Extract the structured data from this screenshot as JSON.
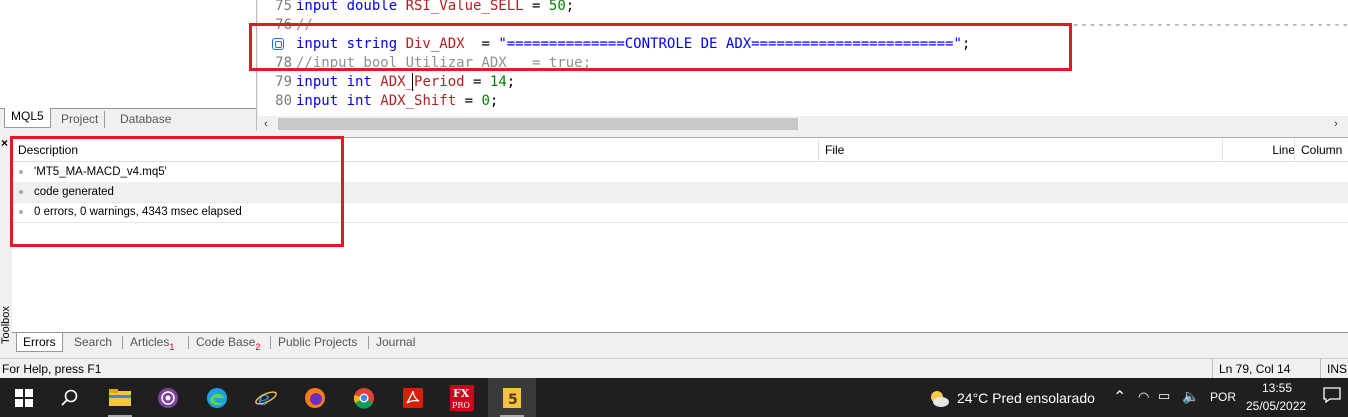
{
  "navigator": {
    "tabs": [
      "MQL5",
      "Project",
      "Database"
    ]
  },
  "editor": {
    "lines": [
      {
        "num": "75",
        "parts": [
          [
            "kw",
            "input double "
          ],
          [
            "var",
            "RSI_Value_SELL"
          ],
          [
            "op",
            " = "
          ],
          [
            "num",
            "50"
          ],
          [
            "op",
            ";"
          ]
        ]
      },
      {
        "num": "76",
        "parts": [
          [
            "cm",
            "//-------------------------------------------------------------------------------------------------------------------------------------------------------------"
          ]
        ]
      },
      {
        "num": "",
        "parts": [
          [
            "kw",
            "input string "
          ],
          [
            "var",
            "Div_ADX"
          ],
          [
            "op",
            "  = "
          ],
          [
            "str",
            "\"==============CONTROLE DE ADX========================\""
          ],
          [
            "op",
            ";"
          ]
        ]
      },
      {
        "num": "78",
        "parts": [
          [
            "cm",
            "//input bool Utilizar_ADX   = true;"
          ]
        ]
      },
      {
        "num": "79",
        "parts": [
          [
            "kw",
            "input int "
          ],
          [
            "var",
            "ADX_Period"
          ],
          [
            "op",
            " = "
          ],
          [
            "num",
            "14"
          ],
          [
            "op",
            ";"
          ]
        ]
      },
      {
        "num": "80",
        "parts": [
          [
            "kw",
            "input int "
          ],
          [
            "var",
            "ADX_Shift"
          ],
          [
            "op",
            " = "
          ],
          [
            "num",
            "0"
          ],
          [
            "op",
            ";"
          ]
        ]
      }
    ]
  },
  "toolbox": {
    "label": "Toolbox",
    "close": "×",
    "columns": {
      "description": "Description",
      "file": "File",
      "line": "Line",
      "column": "Column"
    },
    "rows": [
      "'MT5_MA-MACD_v4.mq5'",
      "code generated",
      "0 errors, 0 warnings, 4343 msec elapsed"
    ],
    "tabs": [
      {
        "label": "Errors",
        "sub": ""
      },
      {
        "label": "Search",
        "sub": ""
      },
      {
        "label": "Articles",
        "sub": "1"
      },
      {
        "label": "Code Base",
        "sub": "2"
      },
      {
        "label": "Public Projects",
        "sub": ""
      },
      {
        "label": "Journal",
        "sub": ""
      }
    ]
  },
  "status": {
    "help": "For Help, press F1",
    "position": "Ln 79, Col 14",
    "mode": "INS"
  },
  "taskbar": {
    "weather": "24°C  Pred ensolarado",
    "lang": "POR",
    "time": "13:55",
    "date": "25/05/2022",
    "apps": [
      "start-icon",
      "search-icon",
      "file-explorer-icon",
      "tor-browser-icon",
      "edge-icon",
      "internet-explorer-icon",
      "firefox-icon",
      "chrome-icon",
      "acrobat-icon",
      "fxpro-icon",
      "metaeditor-icon"
    ]
  },
  "colors": {
    "highlight_box": "#e01b24",
    "keyword": "#0000ff",
    "identifier": "#b22222",
    "number": "#008000"
  }
}
